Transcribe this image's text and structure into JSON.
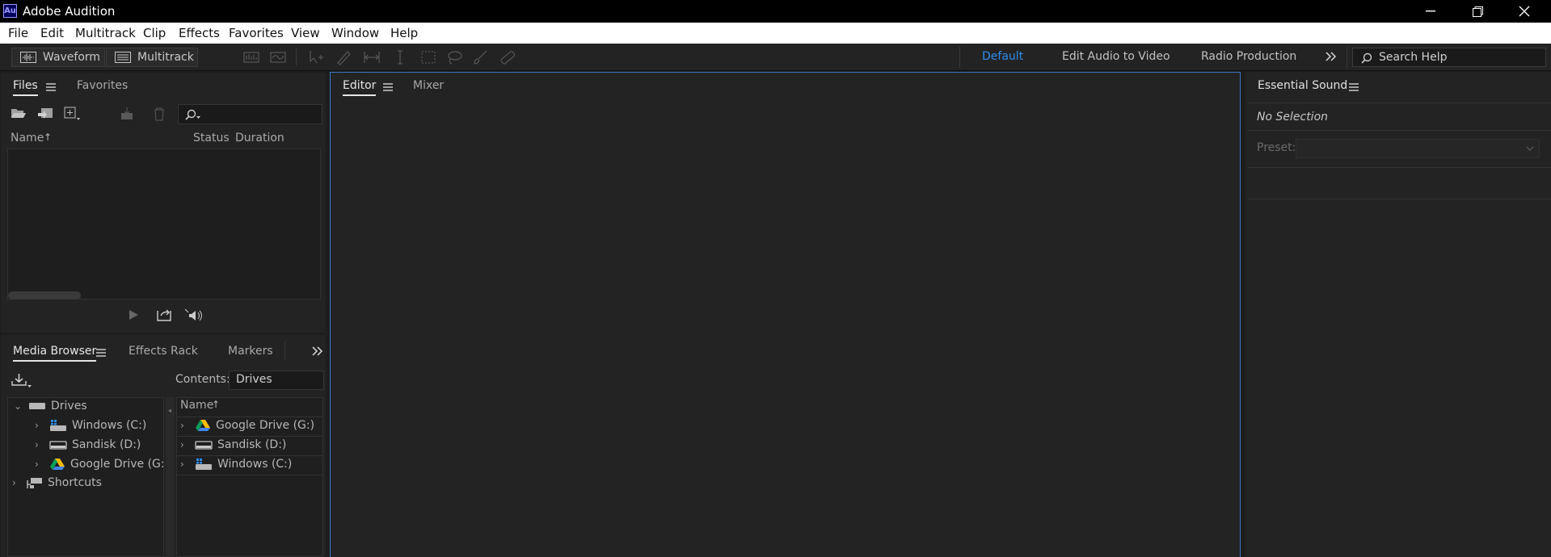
{
  "window": {
    "app_badge": "Au",
    "title": "Adobe Audition"
  },
  "menu": [
    "File",
    "Edit",
    "Multitrack",
    "Clip",
    "Effects",
    "Favorites",
    "View",
    "Window",
    "Help"
  ],
  "toolbar": {
    "waveform_label": "Waveform",
    "multitrack_label": "Multitrack",
    "workspaces": [
      "Default",
      "Edit Audio to Video",
      "Radio Production"
    ],
    "active_workspace": "Default",
    "search_placeholder": "Search Help"
  },
  "files_panel": {
    "tabs": [
      "Files",
      "Favorites"
    ],
    "columns": {
      "name": "Name",
      "status": "Status",
      "duration": "Duration"
    }
  },
  "media_browser": {
    "tabs": [
      "Media Browser",
      "Effects Rack",
      "Markers"
    ],
    "contents_label": "Contents:",
    "contents_value": "Drives",
    "tree": {
      "drives_label": "Drives",
      "children": [
        "Windows (C:)",
        "Sandisk (D:)",
        "Google Drive (G:"
      ],
      "shortcuts_label": "Shortcuts"
    },
    "list_header": "Name",
    "list": [
      "Google Drive (G:)",
      "Sandisk (D:)",
      "Windows (C:)"
    ]
  },
  "editor_panel": {
    "tabs": [
      "Editor",
      "Mixer"
    ]
  },
  "essential_sound": {
    "title": "Essential Sound",
    "status": "No Selection",
    "preset_label": "Preset:"
  },
  "colors": {
    "accent_blue": "#2d8ceb",
    "panel_bg": "#232323",
    "border_active": "#3b78c4"
  }
}
